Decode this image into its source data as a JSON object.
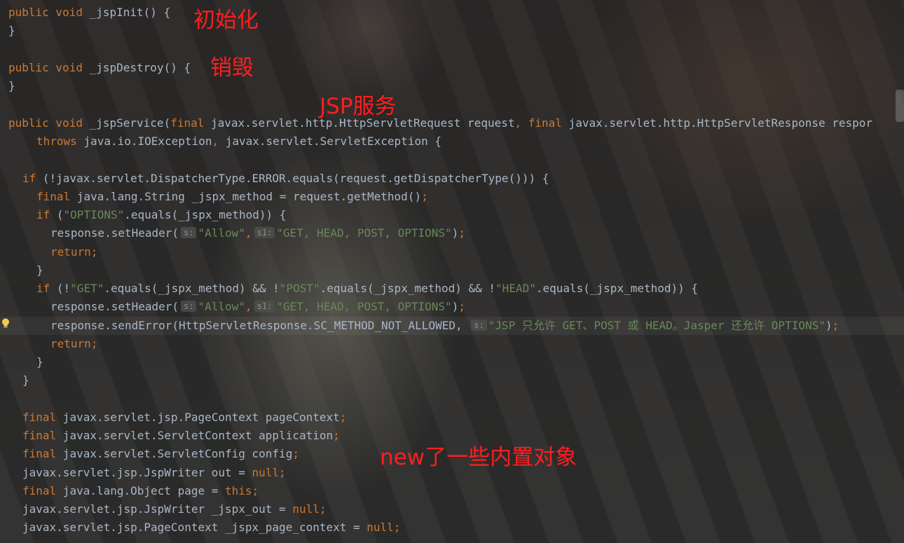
{
  "colors": {
    "keyword": "#cc7832",
    "string": "#6a8759",
    "default": "#a9b7c6",
    "annotation": "#ff1e1e"
  },
  "icons": {
    "gutter": "lightbulb-icon"
  },
  "code": {
    "l1": {
      "kw": "public void",
      "txt": " _jspInit() {"
    },
    "l2": {
      "txt": "}"
    },
    "l3": {
      "kw": "public void",
      "txt": " _jspDestroy() {"
    },
    "l4": {
      "txt": "}"
    },
    "l5": {
      "kw1": "public void",
      "t1": " _jspService(",
      "kw2": "final",
      "t2": " javax.servlet.http.HttpServletRequest request",
      "kw3": ", final",
      "t3": " javax.servlet.http.HttpServletResponse respor"
    },
    "l6": {
      "kw": "throws",
      "t1": " java.io.IOException",
      "kw2": ",",
      "t2": " javax.servlet.ServletException {"
    },
    "l7": {
      "kw": "if",
      "txt": " (!javax.servlet.DispatcherType.ERROR.equals(request.getDispatcherType())) {"
    },
    "l8": {
      "kw": "final",
      "txt": " java.lang.String _jspx_method = request.getMethod()",
      "semi": ";"
    },
    "l9": {
      "kw": "if",
      "t1": " (",
      "s1": "\"OPTIONS\"",
      "t2": ".equals(_jspx_method)) {"
    },
    "l10": {
      "t1": "response.setHeader(",
      "h1": "s:",
      "s1": "\"Allow\"",
      "c1": ",",
      "h2": "s1:",
      "s2": "\"GET, HEAD, POST, OPTIONS\"",
      "t2": ")",
      "semi": ";"
    },
    "l11": {
      "kw": "return;"
    },
    "l12": {
      "txt": "}"
    },
    "l13": {
      "kw": "if",
      "t1": " (!",
      "s1": "\"GET\"",
      "t2": ".equals(_jspx_method) && !",
      "s2": "\"POST\"",
      "t3": ".equals(_jspx_method) && !",
      "s3": "\"HEAD\"",
      "t4": ".equals(_jspx_method)) {"
    },
    "l14": {
      "t1": "response.setHeader(",
      "h1": "s:",
      "s1": "\"Allow\"",
      "c1": ",",
      "h2": "s1:",
      "s2": "\"GET, HEAD, POST, OPTIONS\"",
      "t2": ")",
      "semi": ";"
    },
    "l15": {
      "t1": "response.sendError(HttpServletResponse.SC_METHOD_NOT_ALLOWED,",
      "h1": "s:",
      "s1": "\"JSP 只允许 GET、POST 或 HEAD。Jasper 还允许 OPTIONS\"",
      "t2": ")",
      "semi": ";"
    },
    "l16": {
      "kw": "return;"
    },
    "l17": {
      "txt": "}"
    },
    "l18": {
      "txt": "}"
    },
    "l19": {
      "kw": "final",
      "txt": " javax.servlet.jsp.PageContext pageContext",
      "semi": ";"
    },
    "l20": {
      "kw": "final",
      "txt": " javax.servlet.ServletContext application",
      "semi": ";"
    },
    "l21": {
      "kw": "final",
      "txt": " javax.servlet.ServletConfig config",
      "semi": ";"
    },
    "l22": {
      "txt": "javax.servlet.jsp.JspWriter out = ",
      "kw": "null;"
    },
    "l23": {
      "kw": "final",
      "txt": " java.lang.Object page = ",
      "kw2": "this;"
    },
    "l24": {
      "txt": "javax.servlet.jsp.JspWriter _jspx_out = ",
      "kw": "null;"
    },
    "l25": {
      "txt": "javax.servlet.jsp.PageContext _jspx_page_context = ",
      "kw": "null;"
    }
  },
  "annotations": {
    "init": "初始化",
    "destroy": "销毁",
    "service": "JSP服务",
    "objects": "new了一些内置对象"
  }
}
